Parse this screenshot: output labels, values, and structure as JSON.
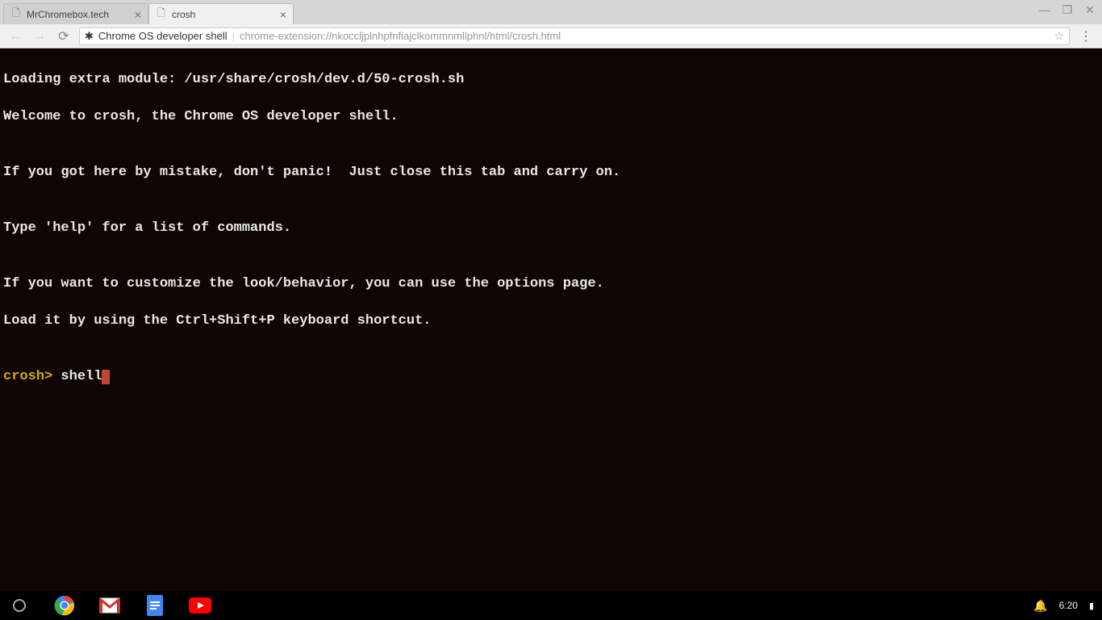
{
  "tabs": [
    {
      "title": "MrChromebox.tech"
    },
    {
      "title": "crosh"
    }
  ],
  "address": {
    "title_label": "Chrome OS developer shell",
    "url": "chrome-extension://nkoccljplnhpfnfiajclkommnmllphnl/html/crosh.html"
  },
  "terminal": {
    "lines": [
      "Loading extra module: /usr/share/crosh/dev.d/50-crosh.sh",
      "Welcome to crosh, the Chrome OS developer shell.",
      "",
      "If you got here by mistake, don't panic!  Just close this tab and carry on.",
      "",
      "Type 'help' for a list of commands.",
      "",
      "If you want to customize the look/behavior, you can use the options page.",
      "Load it by using the Ctrl+Shift+P keyboard shortcut.",
      ""
    ],
    "prompt": "crosh> ",
    "input": "shell"
  },
  "shelf": {
    "time": "6:20"
  }
}
